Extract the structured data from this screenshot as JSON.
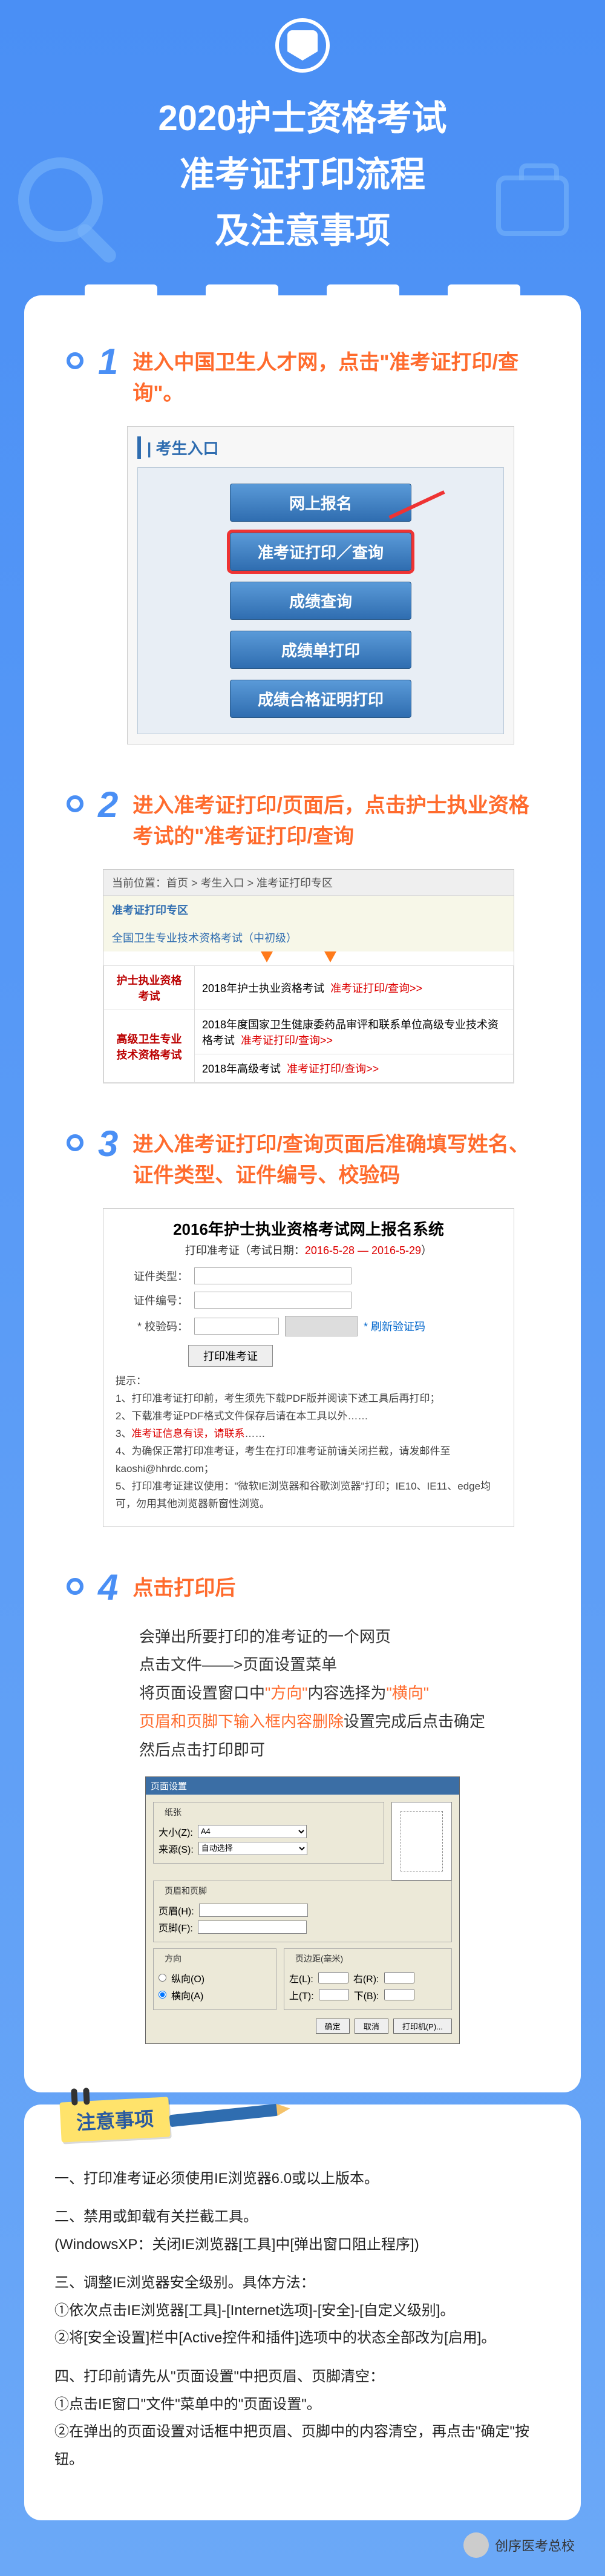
{
  "header": {
    "title_line1": "2020护士资格考试",
    "title_line2": "准考证打印流程",
    "title_line3": "及注意事项"
  },
  "steps": [
    {
      "num": "1",
      "title": "进入中国卫生人才网，点击\"准考证打印/查询\"。",
      "portal_header": "| 考生入口",
      "buttons": [
        "网上报名",
        "准考证打印／查询",
        "成绩查询",
        "成绩单打印",
        "成绩合格证明打印"
      ]
    },
    {
      "num": "2",
      "title": "进入准考证打印/页面后，点击护士执业资格考试的\"准考证打印/查询",
      "crumb": "当前位置：首页 > 考生入口 > 准考证打印专区",
      "section_head1": "准考证打印专区",
      "section_head2": "全国卫生专业技术资格考试（中初级）",
      "rows": [
        {
          "left": "护士执业资格考试",
          "mid": "2018年护士执业资格考试",
          "link": "准考证打印/查询>>"
        },
        {
          "left": "高级卫生专业技术资格考试",
          "mid": "2018年度国家卫生健康委药品审评和联系单位高级专业技术资格考试",
          "link": "准考证打印/查询>>"
        },
        {
          "left": "",
          "mid": "2018年高级考试",
          "link": "准考证打印/查询>>"
        }
      ]
    },
    {
      "num": "3",
      "title": "进入准考证打印/查询页面后准确填写姓名、证件类型、证件编号、校验码",
      "form_title": "2016年护士执业资格考试网上报名系统",
      "form_sub_prefix": "打印准考证（考试日期：",
      "form_sub_date": "2016-5-28 — 2016-5-29",
      "form_sub_suffix": "）",
      "labels": {
        "type": "证件类型：",
        "id": "证件编号：",
        "code": "* 校验码：",
        "refresh": "* 刷新验证码",
        "btn": "打印准考证"
      },
      "notes": [
        "提示：",
        "1、打印准考证打印前，考生须先下载PDF版并阅读下述工具后再打印；",
        "2、下载准考证PDF格式文件保存后请在本工具以外……",
        "3、准考证信息有误，请联系……",
        "4、为确保正常打印准考证，考生在打印准考证前请关闭拦截，请发邮件至kaoshi@hhrdc.com；",
        "5、打印准考证建议使用：\"微软IE浏览器和谷歌浏览器\"打印；IE10、IE11、edge均可，勿用其他浏览器新窗性浏览。"
      ],
      "hl_in_notes": "准考证信息有误，请联系"
    },
    {
      "num": "4",
      "title": "点击打印后",
      "body_lines": [
        "会弹出所要打印的准考证的一个网页",
        "点击文件——>页面设置菜单",
        "将页面设置窗口中\"方向\"内容选择为\"横向\"",
        "页眉和页脚下输入框内容删除设置完成后点击确定",
        "然后点击打印即可"
      ],
      "hl_direction": "\"方向\"",
      "hl_landscape": "\"横向\"",
      "hl_hf": "页眉和页脚下输入框内容删除",
      "dialog": {
        "title": "页面设置",
        "paper": "纸张",
        "size_label": "大小(Z):",
        "size_value": "A4",
        "source_label": "来源(S):",
        "source_value": "自动选择",
        "headerfooter": "页眉和页脚",
        "header_label": "页眉(H):",
        "footer_label": "页脚(F):",
        "orient": "方向",
        "portrait": "纵向(O)",
        "landscape": "横向(A)",
        "margins": "页边距(毫米)",
        "left": "左(L):",
        "right": "右(R):",
        "top": "上(T):",
        "bottom": "下(B):",
        "ok": "确定",
        "cancel": "取消",
        "printer": "打印机(P)..."
      }
    }
  ],
  "notes_section": {
    "tag": "注意事项",
    "items": [
      "一、打印准考证必须使用IE浏览器6.0或以上版本。",
      "二、禁用或卸载有关拦截工具。\n(WindowsXP：关闭IE浏览器[工具]中[弹出窗口阻止程序])",
      "三、调整IE浏览器安全级别。具体方法：\n①依次点击IE浏览器[工具]-[Internet选项]-[安全]-[自定义级别]。\n②将[安全设置]栏中[Active控件和插件]选项中的状态全部改为[启用]。",
      "四、打印前请先从\"页面设置\"中把页眉、页脚清空：\n①点击IE窗口\"文件\"菜单中的\"页面设置\"。\n②在弹出的页面设置对话框中把页眉、页脚中的内容清空，再点击\"确定\"按钮。"
    ]
  },
  "footer": {
    "account": "创序医考总校"
  }
}
